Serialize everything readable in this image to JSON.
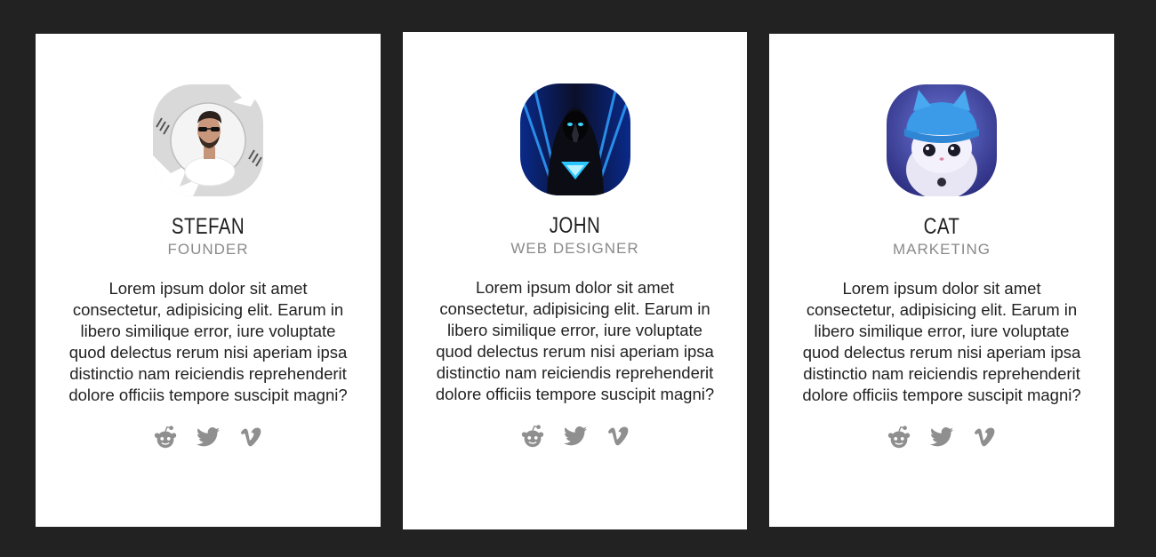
{
  "colors": {
    "page_background": "#222222",
    "card_background": "#ffffff",
    "role_text": "#8a8a8a",
    "icon_gray": "#8f8f8f"
  },
  "cards": [
    {
      "name": "STEFAN",
      "role": "FOUNDER",
      "bio": "Lorem ipsum dolor sit amet consectetur, adipisicing elit. Earum in libero similique error, iure voluptate quod delectus rerum nisi aperiam ipsa distinctio nam reiciendis reprehenderit dolore officiis tempore suscipit magni?",
      "avatar": "man-with-sunglasses-photo",
      "socials": [
        "reddit-icon",
        "twitter-icon",
        "vimeo-icon"
      ]
    },
    {
      "name": "JOHN",
      "role": "WEB DESIGNER",
      "bio": "Lorem ipsum dolor sit amet consectetur, adipisicing elit. Earum in libero similique error, iure voluptate quod delectus rerum nisi aperiam ipsa distinctio nam reiciendis reprehenderit dolore officiis tempore suscipit magni?",
      "avatar": "hooded-figure-photo",
      "socials": [
        "reddit-icon",
        "twitter-icon",
        "vimeo-icon"
      ]
    },
    {
      "name": "CAT",
      "role": "MARKETING",
      "bio": "Lorem ipsum dolor sit amet consectetur, adipisicing elit. Earum in libero similique error, iure voluptate quod delectus rerum nisi aperiam ipsa distinctio nam reiciendis reprehenderit dolore officiis tempore suscipit magni?",
      "avatar": "kitten-in-blue-hat-illustration",
      "socials": [
        "reddit-icon",
        "twitter-icon",
        "vimeo-icon"
      ]
    }
  ]
}
